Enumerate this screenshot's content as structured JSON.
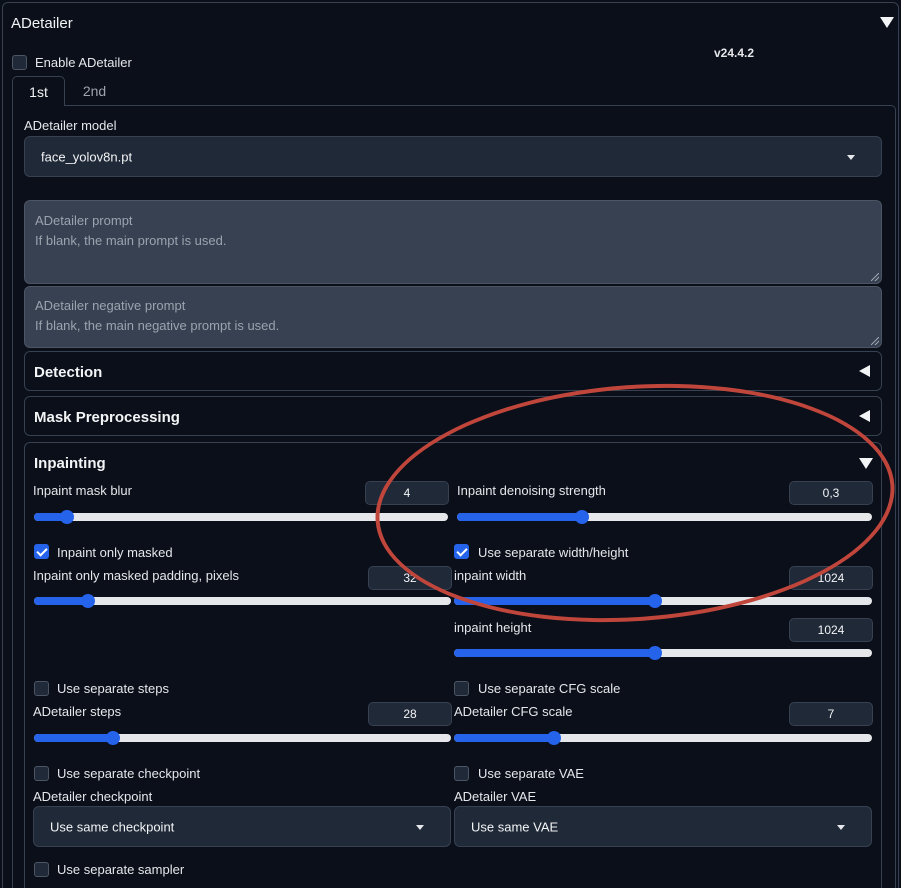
{
  "panel": {
    "title": "ADetailer",
    "version": "v24.4.2",
    "enable_label": "Enable ADetailer",
    "enabled": false
  },
  "tabs": [
    {
      "label": "1st",
      "active": true
    },
    {
      "label": "2nd",
      "active": false
    }
  ],
  "model": {
    "label": "ADetailer model",
    "value": "face_yolov8n.pt"
  },
  "prompt": {
    "placeholder_line1": "ADetailer prompt",
    "placeholder_line2": "If blank, the main prompt is used."
  },
  "negative_prompt": {
    "placeholder_line1": "ADetailer negative prompt",
    "placeholder_line2": "If blank, the main negative prompt is used."
  },
  "sections": {
    "detection": "Detection",
    "mask_preprocessing": "Mask Preprocessing",
    "inpainting": "Inpainting"
  },
  "inpainting": {
    "mask_blur": {
      "label": "Inpaint mask blur",
      "value": "4",
      "fraction": 0.08
    },
    "denoise": {
      "label": "Inpaint denoising strength",
      "value": "0,3",
      "fraction": 0.3
    },
    "only_masked": {
      "label": "Inpaint only masked",
      "checked": true
    },
    "separate_wh": {
      "label": "Use separate width/height",
      "checked": true
    },
    "padding": {
      "label": "Inpaint only masked padding, pixels",
      "value": "32",
      "fraction": 0.13
    },
    "width": {
      "label": "inpaint width",
      "value": "1024",
      "fraction": 0.48
    },
    "height": {
      "label": "inpaint height",
      "value": "1024",
      "fraction": 0.48
    },
    "separate_steps": {
      "label": "Use separate steps",
      "checked": false
    },
    "separate_cfg": {
      "label": "Use separate CFG scale",
      "checked": false
    },
    "steps": {
      "label": "ADetailer steps",
      "value": "28",
      "fraction": 0.19
    },
    "cfg": {
      "label": "ADetailer CFG scale",
      "value": "7",
      "fraction": 0.24
    },
    "separate_checkpoint": {
      "label": "Use separate checkpoint",
      "checked": false
    },
    "separate_vae": {
      "label": "Use separate VAE",
      "checked": false
    },
    "checkpoint": {
      "label": "ADetailer checkpoint",
      "value": "Use same checkpoint"
    },
    "vae": {
      "label": "ADetailer VAE",
      "value": "Use same VAE"
    },
    "separate_sampler": {
      "label": "Use separate sampler",
      "checked": false
    }
  },
  "colors": {
    "accent": "#2563eb",
    "annotation": "#c0463c",
    "background": "#0b0f19"
  }
}
